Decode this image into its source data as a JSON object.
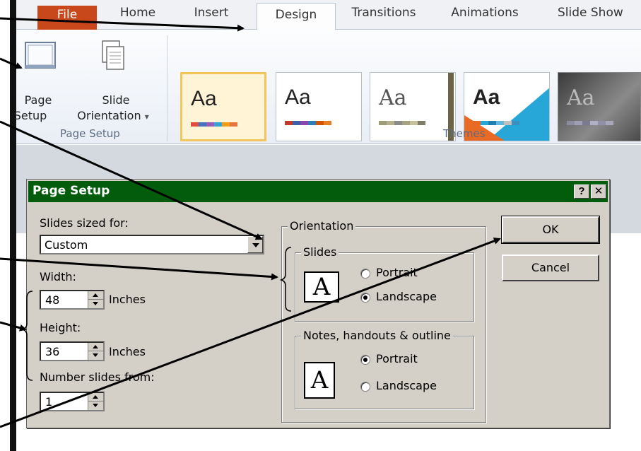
{
  "ribbon": {
    "tabs": {
      "file": "File",
      "home": "Home",
      "insert": "Insert",
      "design": "Design",
      "transitions": "Transitions",
      "animations": "Animations",
      "slide_show": "Slide Show"
    },
    "page_setup_label_1": "Page",
    "page_setup_label_2": "Setup",
    "slide_orientation_label_1": "Slide",
    "slide_orientation_label_2": "Orientation",
    "slide_orientation_arrow": "▾",
    "page_setup_group": "Page Setup",
    "themes_group": "Themes",
    "themes": [
      {
        "sample": "Aa",
        "selected": true
      },
      {
        "sample": "Aa",
        "selected": false
      },
      {
        "sample": "Aa",
        "selected": false
      },
      {
        "sample": "Aa",
        "selected": false
      },
      {
        "sample": "Aa",
        "selected": false
      }
    ]
  },
  "dialog": {
    "title": "Page Setup",
    "help_button": "?",
    "close_button": "✕",
    "slides_sized_for_label": "Slides sized for:",
    "slides_sized_for_value": "Custom",
    "width_label": "Width:",
    "width_value": "48",
    "width_unit": "Inches",
    "height_label": "Height:",
    "height_value": "36",
    "height_unit": "Inches",
    "number_slides_from_label": "Number slides from:",
    "number_slides_from_value": "1",
    "orientation_label": "Orientation",
    "slides_group_label": "Slides",
    "slides_portrait": "Portrait",
    "slides_landscape": "Landscape",
    "slides_selected": "Landscape",
    "notes_group_label": "Notes, handouts & outline",
    "notes_portrait": "Portrait",
    "notes_landscape": "Landscape",
    "notes_selected": "Portrait",
    "orientation_icon_glyph": "A",
    "ok_button": "OK",
    "cancel_button": "Cancel"
  },
  "colors": {
    "file_tab": "#c8481c",
    "dialog_title_bar": "#035b0c",
    "dialog_face": "#d4d0c8",
    "theme_selected_border": "#f4c55a"
  }
}
